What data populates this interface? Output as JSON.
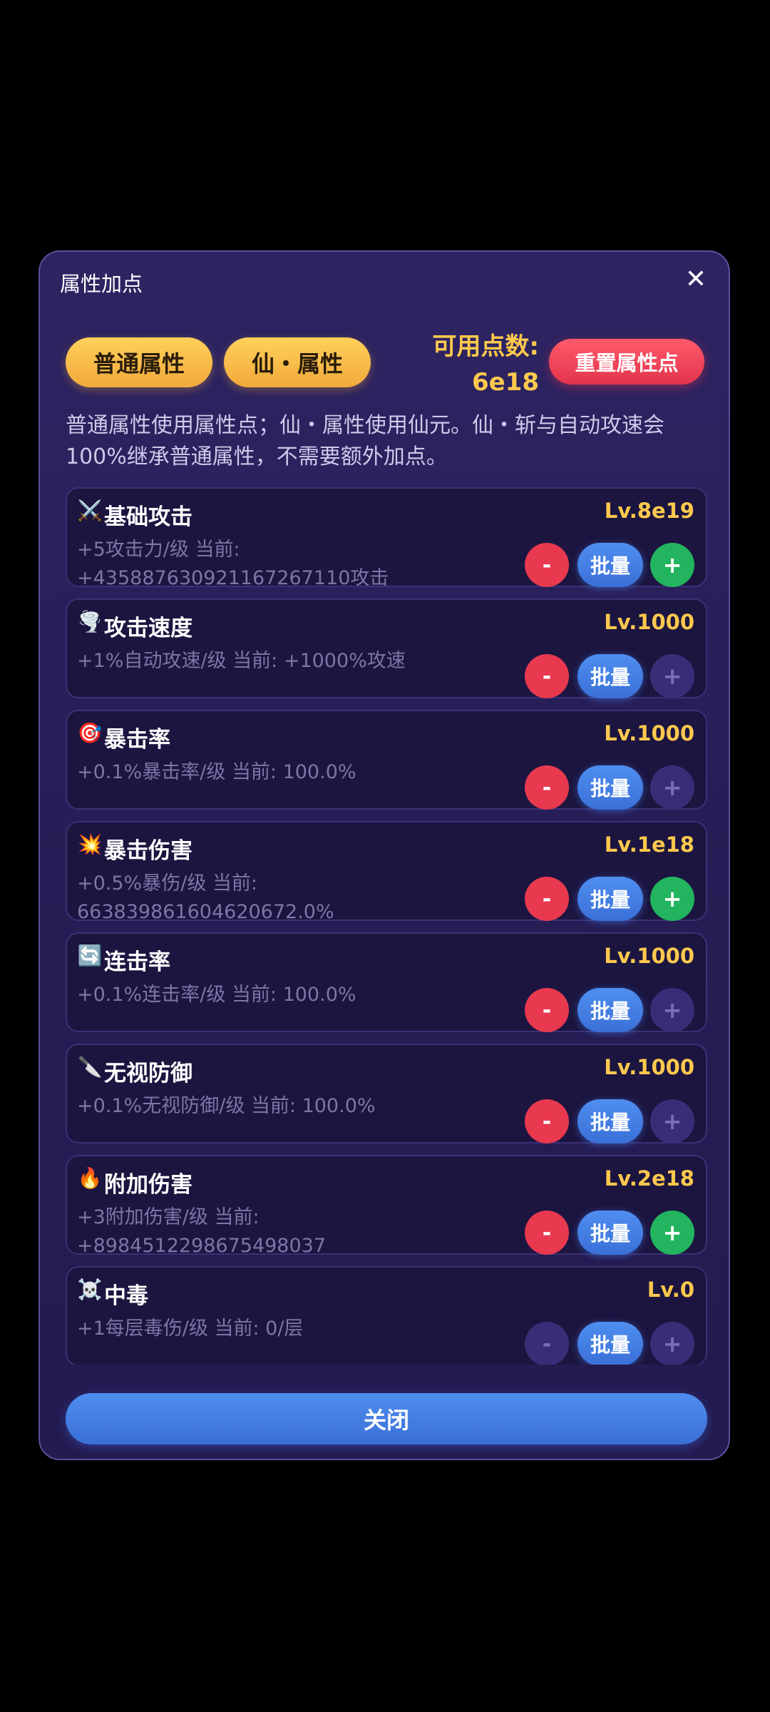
{
  "dialog": {
    "title": "属性加点",
    "close_icon": "✕"
  },
  "tabs": [
    {
      "label": "普通属性"
    },
    {
      "label": "仙・属性"
    }
  ],
  "points": {
    "label": "可用点数:",
    "value": "6e18"
  },
  "reset_label": "重置属性点",
  "description": "普通属性使用属性点；仙・属性使用仙元。仙・斩与自动攻速会100%继承普通属性，不需要额外加点。",
  "buttons": {
    "minus": "-",
    "batch": "批量",
    "plus": "+"
  },
  "attributes": [
    {
      "icon": "⚔️",
      "icon_name": "crossed-swords-icon",
      "name": "基础攻击",
      "level": "Lv.8e19",
      "info": "+5攻击力/级  当前: +435887630921167267110攻击",
      "minus_enabled": true,
      "plus_enabled": true
    },
    {
      "icon": "🌪️",
      "icon_name": "tornado-icon",
      "name": "攻击速度",
      "level": "Lv.1000",
      "info": "+1%自动攻速/级  当前: +1000%攻速",
      "minus_enabled": true,
      "plus_enabled": false
    },
    {
      "icon": "🎯",
      "icon_name": "target-icon",
      "name": "暴击率",
      "level": "Lv.1000",
      "info": "+0.1%暴击率/级  当前: 100.0%",
      "minus_enabled": true,
      "plus_enabled": false
    },
    {
      "icon": "💥",
      "icon_name": "explosion-icon",
      "name": "暴击伤害",
      "level": "Lv.1e18",
      "info": "+0.5%暴伤/级  当前: 663839861604620672.0%",
      "minus_enabled": true,
      "plus_enabled": true
    },
    {
      "icon": "🔄",
      "icon_name": "refresh-icon",
      "name": "连击率",
      "level": "Lv.1000",
      "info": "+0.1%连击率/级  当前: 100.0%",
      "minus_enabled": true,
      "plus_enabled": false
    },
    {
      "icon": "🔪",
      "icon_name": "knife-icon",
      "name": "无视防御",
      "level": "Lv.1000",
      "info": "+0.1%无视防御/级  当前: 100.0%",
      "minus_enabled": true,
      "plus_enabled": false
    },
    {
      "icon": "🔥",
      "icon_name": "fire-icon",
      "name": "附加伤害",
      "level": "Lv.2e18",
      "info": "+3附加伤害/级  当前: +8984512298675498037",
      "minus_enabled": true,
      "plus_enabled": true
    },
    {
      "icon": "☠️",
      "icon_name": "skull-icon",
      "name": "中毒",
      "level": "Lv.0",
      "info": "+1每层毒伤/级  当前: 0/层",
      "minus_enabled": false,
      "plus_enabled": false
    }
  ],
  "close_label": "关闭",
  "colors": {
    "gold": "#ffc94d",
    "red": "#e8394f",
    "blue": "#4f8ef0",
    "green": "#22b45e"
  }
}
